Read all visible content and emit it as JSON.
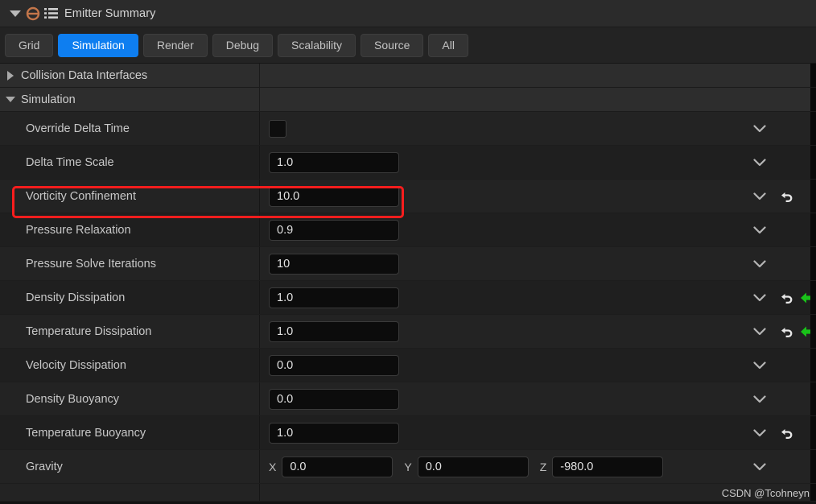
{
  "window": {
    "title": "Emitter Summary",
    "collapse_icon": "triangle-down-icon",
    "emitter_icon": "emitter-node-icon",
    "list_icon": "list-icon"
  },
  "tabs": [
    {
      "label": "Grid",
      "active": false
    },
    {
      "label": "Simulation",
      "active": true
    },
    {
      "label": "Render",
      "active": false
    },
    {
      "label": "Debug",
      "active": false
    },
    {
      "label": "Scalability",
      "active": false
    },
    {
      "label": "Source",
      "active": false
    },
    {
      "label": "All",
      "active": false
    }
  ],
  "sections": [
    {
      "label": "Collision Data Interfaces",
      "expanded": false
    },
    {
      "label": "Simulation",
      "expanded": true
    }
  ],
  "properties": [
    {
      "name": "Override Delta Time",
      "type": "checkbox",
      "checked": false,
      "has_chevron": true,
      "has_reset": false,
      "has_green_arrow": false,
      "highlighted": false
    },
    {
      "name": "Delta Time Scale",
      "type": "number",
      "value": "1.0",
      "has_chevron": true,
      "has_reset": false,
      "has_green_arrow": false,
      "highlighted": false
    },
    {
      "name": "Vorticity Confinement",
      "type": "number",
      "value": "10.0",
      "has_chevron": true,
      "has_reset": true,
      "has_green_arrow": false,
      "highlighted": true
    },
    {
      "name": "Pressure Relaxation",
      "type": "number",
      "value": "0.9",
      "has_chevron": true,
      "has_reset": false,
      "has_green_arrow": false,
      "highlighted": false
    },
    {
      "name": "Pressure Solve Iterations",
      "type": "number",
      "value": "10",
      "has_chevron": true,
      "has_reset": false,
      "has_green_arrow": false,
      "highlighted": false
    },
    {
      "name": "Density Dissipation",
      "type": "number",
      "value": "1.0",
      "has_chevron": true,
      "has_reset": true,
      "has_green_arrow": true,
      "highlighted": false
    },
    {
      "name": "Temperature Dissipation",
      "type": "number",
      "value": "1.0",
      "has_chevron": true,
      "has_reset": true,
      "has_green_arrow": true,
      "highlighted": false
    },
    {
      "name": "Velocity Dissipation",
      "type": "number",
      "value": "0.0",
      "has_chevron": true,
      "has_reset": false,
      "has_green_arrow": false,
      "highlighted": false
    },
    {
      "name": "Density Buoyancy",
      "type": "number",
      "value": "0.0",
      "has_chevron": true,
      "has_reset": false,
      "has_green_arrow": false,
      "highlighted": false
    },
    {
      "name": "Temperature Buoyancy",
      "type": "number",
      "value": "1.0",
      "has_chevron": true,
      "has_reset": true,
      "has_green_arrow": false,
      "highlighted": false
    },
    {
      "name": "Gravity",
      "type": "vector3",
      "axes": [
        {
          "label": "X",
          "value": "0.0"
        },
        {
          "label": "Y",
          "value": "0.0"
        },
        {
          "label": "Z",
          "value": "-980.0"
        }
      ],
      "has_chevron": true,
      "has_reset": false,
      "has_green_arrow": false,
      "highlighted": false
    }
  ],
  "colors": {
    "accent": "#0e7ef0",
    "highlight": "#fc1d1d",
    "green_arrow": "#19c219",
    "panel_bg": "#232323",
    "titlebar_bg": "#2b2b2b"
  },
  "watermark": "CSDN @Tcohneyn"
}
